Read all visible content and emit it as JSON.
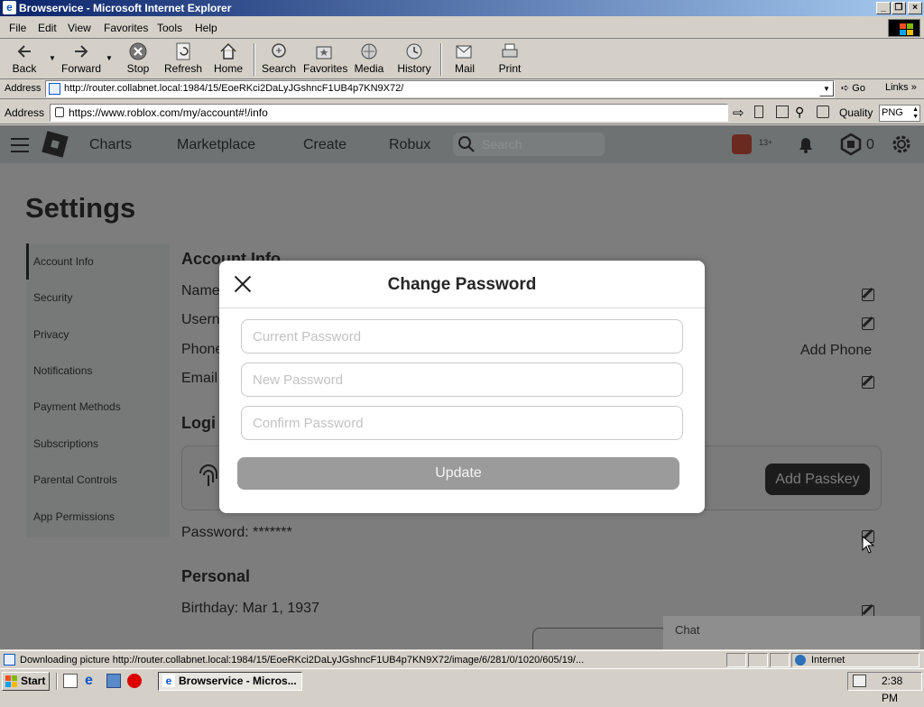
{
  "window": {
    "title": "Browservice - Microsoft Internet Explorer"
  },
  "menu": {
    "file": "File",
    "edit": "Edit",
    "view": "View",
    "favorites": "Favorites",
    "tools": "Tools",
    "help": "Help"
  },
  "toolbar": {
    "back": "Back",
    "forward": "Forward",
    "stop": "Stop",
    "refresh": "Refresh",
    "home": "Home",
    "search": "Search",
    "favorites": "Favorites",
    "media": "Media",
    "history": "History",
    "mail": "Mail",
    "print": "Print"
  },
  "address": {
    "label": "Address",
    "url": "http://router.collabnet.local:1984/15/EoeRKci2DaLyJGshncF1UB4p7KN9X72/",
    "go": "Go",
    "links": "Links"
  },
  "inner": {
    "label": "Address",
    "url": "https://www.roblox.com/my/account#!/info",
    "quality_label": "Quality",
    "quality_value": "PNG"
  },
  "roblox_nav": {
    "charts": "Charts",
    "marketplace": "Marketplace",
    "create": "Create",
    "robux": "Robux",
    "search_placeholder": "Search",
    "age_badge": "13+",
    "robux_count": "0"
  },
  "settings": {
    "title": "Settings",
    "nav": [
      "Account Info",
      "Security",
      "Privacy",
      "Notifications",
      "Payment Methods",
      "Subscriptions",
      "Parental Controls",
      "App Permissions"
    ],
    "account_info_heading": "Account Info",
    "rows": {
      "name": "Name",
      "username": "Usern",
      "phone": "Phone",
      "email": "Email"
    },
    "add_phone": "Add Phone",
    "login_heading": "Logi",
    "add_passkey": "Add Passkey",
    "password": "Password: *******",
    "personal_heading": "Personal",
    "birthday": "Birthday:  Mar 1, 1937"
  },
  "modal": {
    "title": "Change Password",
    "current_placeholder": "Current Password",
    "new_placeholder": "New Password",
    "confirm_placeholder": "Confirm Password",
    "update": "Update"
  },
  "chat": {
    "label": "Chat"
  },
  "status": {
    "text": "Downloading picture http://router.collabnet.local:1984/15/EoeRKci2DaLyJGshncF1UB4p7KN9X72/image/6/281/0/1020/605/19/...",
    "zone": "Internet"
  },
  "taskbar": {
    "start": "Start",
    "task": "Browservice - Micros...",
    "clock": "2:38 PM"
  }
}
